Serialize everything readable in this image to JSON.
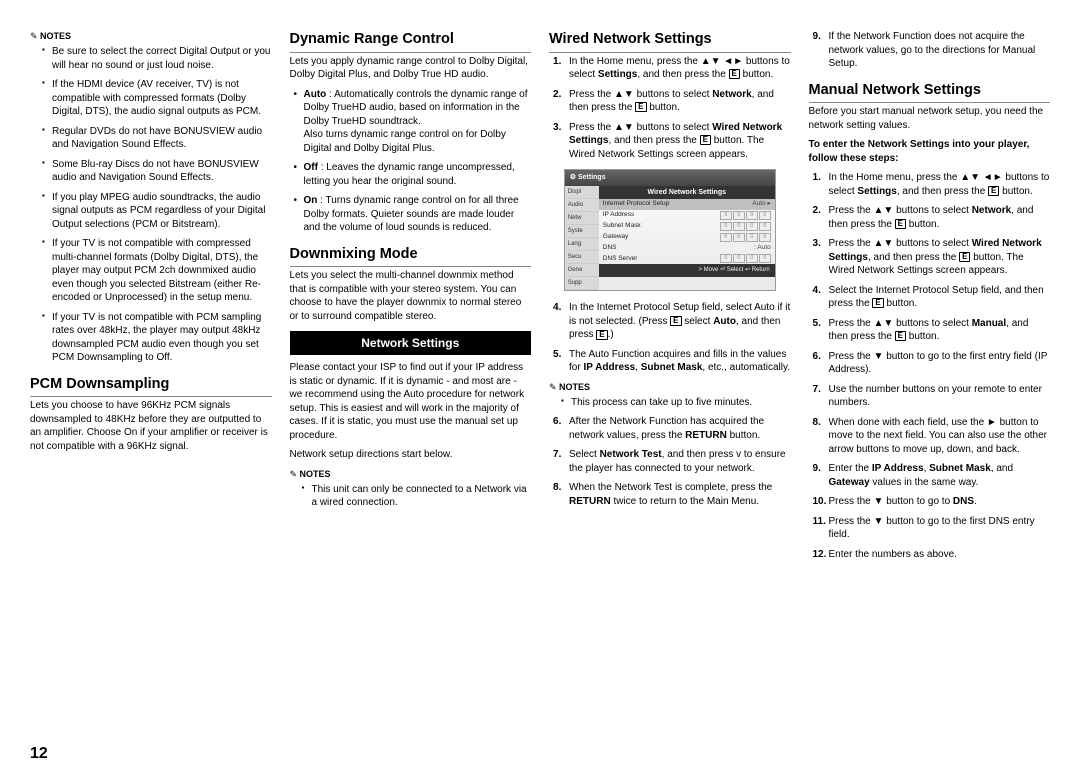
{
  "page_number": "12",
  "col1": {
    "notes_label": "Notes",
    "notes": [
      "Be sure to select the correct Digital Output or you will hear no sound or just loud noise.",
      "If the HDMI device (AV receiver, TV) is not compatible with compressed formats (Dolby Digital, DTS), the audio signal outputs as PCM.",
      "Regular DVDs do not have BONUSVIEW audio and Navigation Sound Effects.",
      "Some Blu-ray Discs do not have BONUSVIEW audio and Navigation Sound Effects.",
      "If you play MPEG audio soundtracks, the audio signal outputs as PCM regardless of your Digital Output selections (PCM or Bitstream).",
      "If your TV is not compatible with compressed multi-channel formats (Dolby Digital, DTS), the player may output PCM 2ch downmixed audio even though you selected Bitstream (either Re-encoded or Unprocessed) in the setup menu.",
      "If your TV is not compatible with PCM sampling rates over 48kHz, the player may output 48kHz downsampled PCM audio even though you set PCM Downsampling to Off."
    ],
    "pcm_title": "PCM Downsampling",
    "pcm_body": "Lets you choose to have 96KHz PCM signals downsampled to 48KHz before they are outputted to an amplifier. Choose On if your amplifier or receiver is not compatible with a 96KHz signal."
  },
  "col2": {
    "drc_title": "Dynamic Range Control",
    "drc_body": "Lets you apply dynamic range control to Dolby Digital, Dolby Digital Plus, and Dolby True HD audio.",
    "drc_items": [
      "Auto : Automatically controls the dynamic range of Dolby TrueHD audio, based on information in the Dolby TrueHD soundtrack.\nAlso turns dynamic range control on for Dolby Digital and Dolby Digital Plus.",
      "Off : Leaves the dynamic range uncompressed, letting you hear the original sound.",
      "On : Turns dynamic range control on for all three Dolby formats. Quieter sounds are made louder and the volume of loud sounds is reduced."
    ],
    "dm_title": "Downmixing Mode",
    "dm_body": "Lets you select the multi-channel downmix method that is compatible with your stereo system. You can choose to have the player downmix to normal stereo or to surround compatible stereo.",
    "ns_bar": "Network Settings",
    "ns_body1": "Please contact your ISP to find out if your IP address is static or dynamic. If it is dynamic - and most are - we recommend using the Auto procedure for network setup. This is easiest and will work in the majority of cases. If it is static, you must use the manual set up procedure.",
    "ns_body2": "Network setup directions start below.",
    "ns_notes_label": "Notes",
    "ns_note": "This unit can only be connected to a Network via a wired connection."
  },
  "col3": {
    "wns_title": "Wired Network Settings",
    "steps_a": [
      "In the Home menu, press the ▲▼ ◄► buttons to select Settings, and then press the E button.",
      "Press the ▲▼ buttons to select Network, and then press the E button.",
      "Press the ▲▼ buttons to select Wired Network Settings, and then press the E button. The Wired Network Settings screen appears."
    ],
    "steps_b_start": 4,
    "steps_b": [
      "In the Internet Protocol Setup field, select Auto if it is not selected. (Press E select Auto, and then press E.)",
      "The Auto Function acquires and fills in the values for IP Address, Subnet Mask, etc., automatically."
    ],
    "mid_notes_label": "Notes",
    "mid_note": "This process can take up to five minutes.",
    "steps_c_start": 6,
    "steps_c": [
      "After the Network Function has acquired the network values, press the RETURN button.",
      "Select Network Test, and then press v to ensure the player has connected to your network.",
      "When the Network Test is complete, press the RETURN twice to return to the Main Menu."
    ],
    "osd": {
      "top": "Settings",
      "title": "Wired Network Settings",
      "side": [
        "Displ",
        "Audio",
        "Netw",
        "Syste",
        "Lang",
        "Secu",
        "Gene",
        "Supp"
      ],
      "rows": [
        {
          "label": "Internet Protocol Setup",
          "value": "Auto",
          "hl": true,
          "boxes": false,
          "arrow": true
        },
        {
          "label": "IP Address",
          "boxes": true
        },
        {
          "label": "Subnet Mask",
          "boxes": true
        },
        {
          "label": "Gateway",
          "boxes": true
        },
        {
          "label": "DNS",
          "value": ": Auto"
        },
        {
          "label": "DNS Server",
          "boxes": true
        }
      ],
      "foot": "> Move   ⏎ Select   ↩ Return"
    }
  },
  "col4": {
    "cont_start": 9,
    "cont": [
      "If the Network Function does not acquire the network values, go to the directions for Manual Setup."
    ],
    "mns_title": "Manual Network Settings",
    "mns_intro": "Before you start manual network setup, you need the network setting values.",
    "mns_bold": "To enter the Network Settings into your player, follow these steps:",
    "mns_steps": [
      "In the Home menu, press the ▲▼ ◄► buttons to select Settings, and then press the E button.",
      "Press the ▲▼ buttons to select Network, and then press the E button.",
      "Press the ▲▼ buttons to select Wired Network Settings, and then press the E button. The Wired Network Settings screen appears.",
      "Select the Internet Protocol Setup field, and then press the E button.",
      "Press the ▲▼ buttons to select Manual, and then press the E button.",
      "Press the ▼ button to go to the first entry field (IP Address).",
      "Use the number buttons on your remote to enter numbers.",
      "When done with each field, use the ► button to move to the next field. You can also use the other arrow buttons to move up, down, and back.",
      "Enter the IP Address, Subnet Mask, and Gateway values in the same way.",
      "Press the ▼ button to go to DNS.",
      "Press the ▼ button to go to the first DNS entry field.",
      "Enter the numbers as above."
    ]
  }
}
